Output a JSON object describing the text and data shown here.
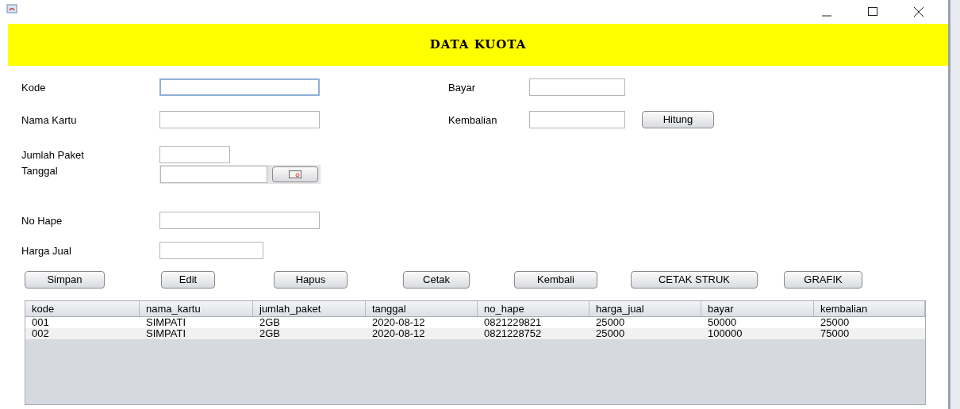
{
  "window": {
    "title": "DATA KUOTA"
  },
  "left_fields": [
    {
      "label": "Kode",
      "kind": "text",
      "focused": true
    },
    {
      "label": "Nama Kartu",
      "kind": "text",
      "focused": false
    },
    {
      "label": "Jumlah Paket",
      "kind": "text",
      "focused": false
    },
    {
      "label": "Tanggal",
      "kind": "date",
      "focused": false
    },
    {
      "label": "No Hape",
      "kind": "text",
      "focused": false
    },
    {
      "label": "Harga Jual",
      "kind": "text",
      "focused": false
    }
  ],
  "right_fields": [
    {
      "label": "Bayar",
      "focused": false
    },
    {
      "label": "Kembalian",
      "focused": false
    }
  ],
  "hitung_button": "Hitung",
  "buttons": [
    "Simpan",
    "Edit",
    "Hapus",
    "Cetak",
    "Kembali",
    "CETAK STRUK",
    "GRAFIK"
  ],
  "table": {
    "columns": [
      "kode",
      "nama_kartu",
      "jumlah_paket",
      "tanggal",
      "no_hape",
      "harga_jual",
      "bayar",
      "kembalian"
    ],
    "rows": [
      [
        "001",
        "SIMPATI",
        "2GB",
        "2020-08-12",
        "0821229821",
        "25000",
        "50000",
        "25000"
      ],
      [
        "002",
        "SIMPATI",
        "2GB",
        "2020-08-12",
        "0821228752",
        "25000",
        "100000",
        "75000"
      ]
    ]
  }
}
